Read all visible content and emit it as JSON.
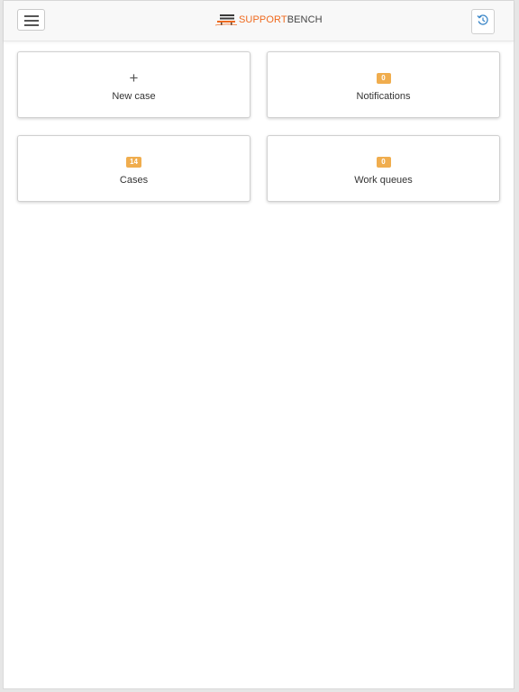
{
  "header": {
    "logo_text_orange": "SUPPORT",
    "logo_text_dark": "BENCH",
    "menu_icon": "hamburger-icon",
    "history_icon": "history-icon",
    "brand_color": "#ef6a1f"
  },
  "tiles": {
    "new_case": {
      "icon": "+",
      "label": "New case"
    },
    "notifications": {
      "count": "0",
      "label": "Notifications"
    },
    "cases": {
      "count": "14",
      "label": "Cases"
    },
    "work_queues": {
      "count": "0",
      "label": "Work queues"
    }
  },
  "colors": {
    "badge": "#f0ad4e"
  }
}
